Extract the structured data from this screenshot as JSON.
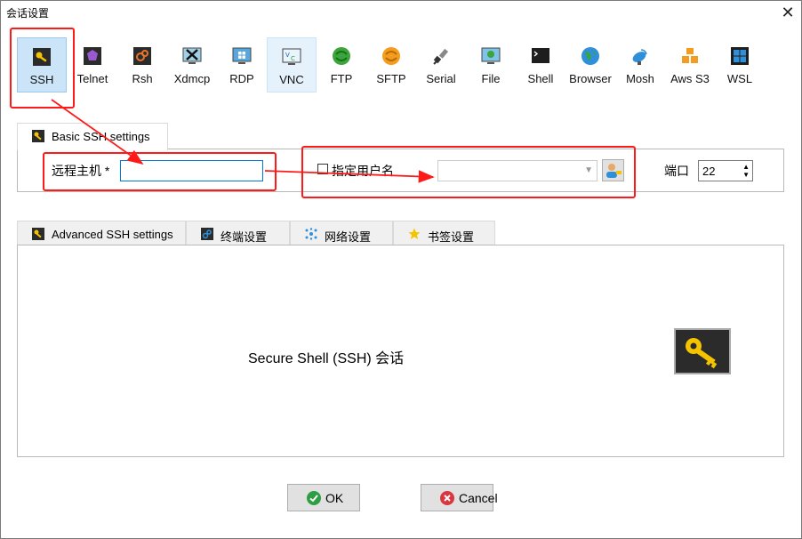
{
  "window": {
    "title": "会话设置",
    "close_glyph": "✕"
  },
  "protocols": [
    {
      "label": "SSH",
      "icon": "ssh-key-icon",
      "selected": true
    },
    {
      "label": "Telnet",
      "icon": "telnet-icon"
    },
    {
      "label": "Rsh",
      "icon": "rsh-icon"
    },
    {
      "label": "Xdmcp",
      "icon": "xdmcp-icon"
    },
    {
      "label": "RDP",
      "icon": "rdp-icon"
    },
    {
      "label": "VNC",
      "icon": "vnc-icon",
      "hover": true
    },
    {
      "label": "FTP",
      "icon": "ftp-icon"
    },
    {
      "label": "SFTP",
      "icon": "sftp-icon"
    },
    {
      "label": "Serial",
      "icon": "serial-icon"
    },
    {
      "label": "File",
      "icon": "file-icon"
    },
    {
      "label": "Shell",
      "icon": "shell-icon"
    },
    {
      "label": "Browser",
      "icon": "browser-icon"
    },
    {
      "label": "Mosh",
      "icon": "mosh-icon"
    },
    {
      "label": "Aws S3",
      "icon": "aws-s3-icon"
    },
    {
      "label": "WSL",
      "icon": "wsl-icon"
    }
  ],
  "basic_tab": {
    "label": "Basic SSH settings"
  },
  "basic": {
    "remote_host_label": "远程主机 *",
    "remote_host_value": "",
    "specify_user_label": "指定用户名",
    "username_value": "",
    "port_label": "端口",
    "port_value": "22"
  },
  "sub_tabs": [
    {
      "label": "Advanced SSH settings",
      "icon": "wrench-icon"
    },
    {
      "label": "终端设置",
      "icon": "terminal-icon"
    },
    {
      "label": "网络设置",
      "icon": "network-icon"
    },
    {
      "label": "书签设置",
      "icon": "star-icon"
    }
  ],
  "description": "Secure Shell (SSH) 会话",
  "buttons": {
    "ok": "OK",
    "cancel": "Cancel"
  },
  "colors": {
    "selected_bg": "#cce4f7",
    "annotation_red": "#ff1a1a",
    "focus_blue": "#0078d7",
    "ok_green": "#2e9e44",
    "cancel_red": "#d9363e"
  }
}
